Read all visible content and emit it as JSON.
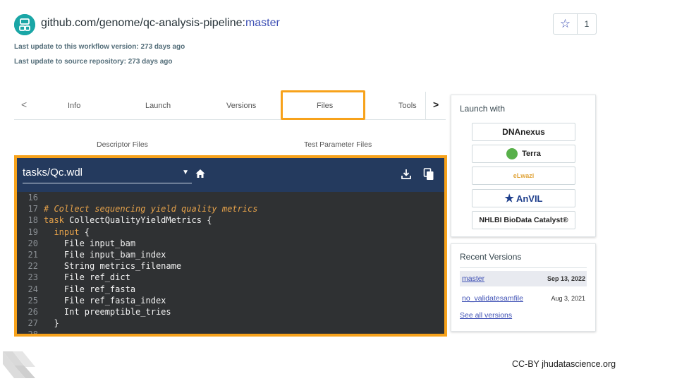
{
  "header": {
    "repo": "github.com/genome/qc-analysis-pipeline:",
    "branch": "master",
    "last_update_version": "Last update to this workflow version: 273 days ago",
    "last_update_repo": "Last update to source repository: 273 days ago",
    "star_count": "1"
  },
  "tabs": {
    "items": [
      "Info",
      "Launch",
      "Versions",
      "Files",
      "Tools"
    ],
    "active": "Files",
    "highlight_color": "#f7a21b"
  },
  "subtabs": [
    "Descriptor Files",
    "Test Parameter Files"
  ],
  "editor": {
    "file": "tasks/Qc.wdl",
    "lines": [
      {
        "n": "16",
        "text": ""
      },
      {
        "n": "17",
        "text": "# Collect sequencing yield quality metrics"
      },
      {
        "n": "18",
        "kw": "task",
        "text": " CollectQualityYieldMetrics {"
      },
      {
        "n": "19",
        "kw": "  input",
        "text": " {"
      },
      {
        "n": "20",
        "text": "    File input_bam"
      },
      {
        "n": "21",
        "text": "    File input_bam_index"
      },
      {
        "n": "22",
        "text": "    String metrics_filename"
      },
      {
        "n": "23",
        "text": "    File ref_dict"
      },
      {
        "n": "24",
        "text": "    File ref_fasta"
      },
      {
        "n": "25",
        "text": "    File ref_fasta_index"
      },
      {
        "n": "26",
        "text": "    Int preemptible_tries"
      },
      {
        "n": "27",
        "text": "  }"
      },
      {
        "n": "28",
        "text": ""
      }
    ]
  },
  "launch_with": {
    "title": "Launch with",
    "platforms": [
      "DNAnexus",
      "Terra",
      "eLwazi",
      "AnVIL",
      "NHLBI BioData Catalyst®"
    ]
  },
  "recent_versions": {
    "title": "Recent Versions",
    "items": [
      {
        "name": "master",
        "date": "Sep 13, 2022"
      },
      {
        "name": "no_validatesamfile",
        "date": "Aug 3, 2021"
      }
    ],
    "see_all": "See all versions"
  },
  "footer": {
    "license": "CC-BY  jhudatascience.org"
  }
}
